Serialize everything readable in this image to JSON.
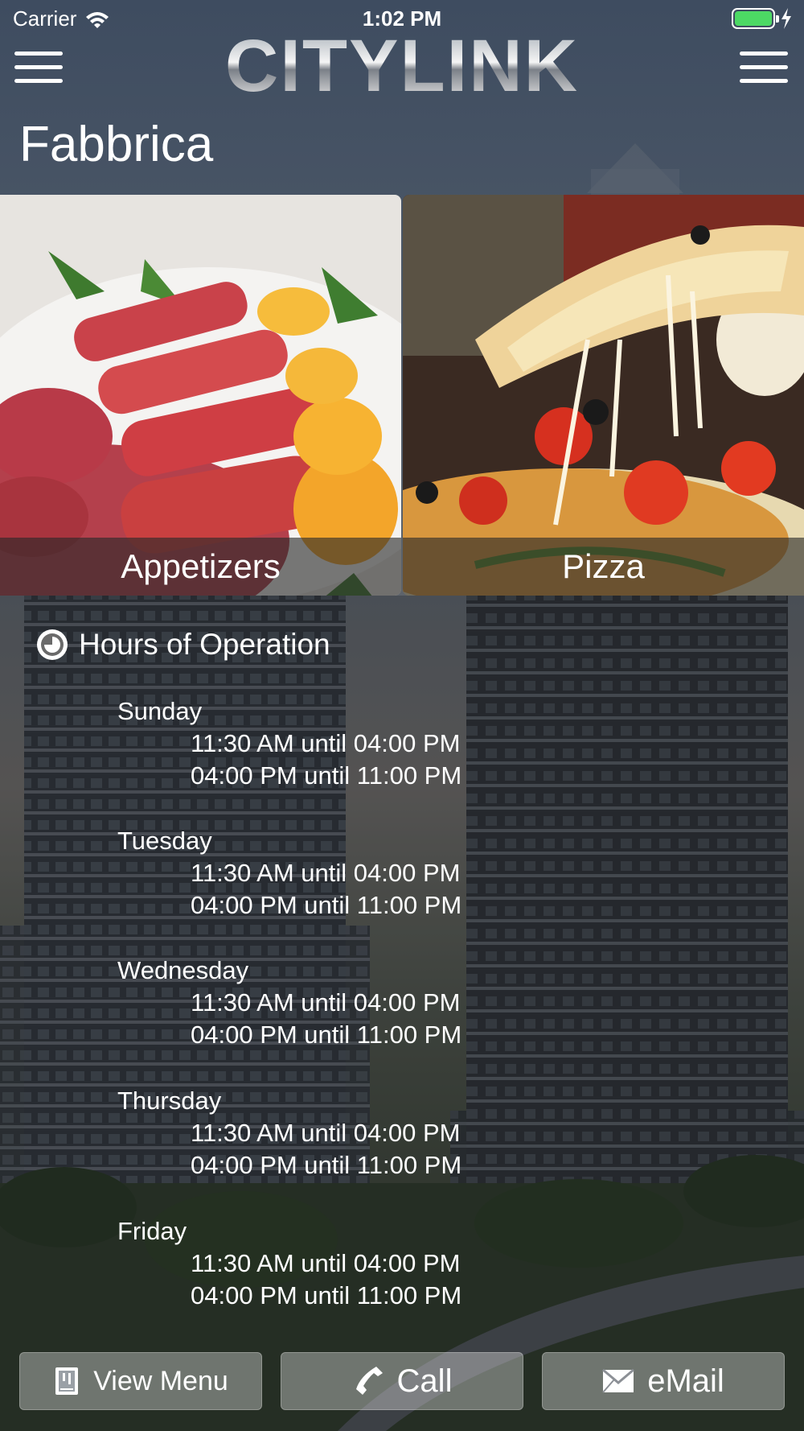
{
  "status_bar": {
    "carrier": "Carrier",
    "time": "1:02 PM",
    "battery_color": "#4cd964"
  },
  "header": {
    "logo_text": "CITYLINK",
    "left_menu_icon": "hamburger-icon",
    "right_menu_icon": "hamburger-icon"
  },
  "page": {
    "title": "Fabbrica"
  },
  "categories": [
    {
      "label": "Appetizers"
    },
    {
      "label": "Pizza"
    }
  ],
  "hours": {
    "title": "Hours of Operation",
    "icon": "clock-icon",
    "days": [
      {
        "day": "Sunday",
        "slots": [
          "11:30 AM until 04:00 PM",
          "04:00 PM until 11:00 PM"
        ]
      },
      {
        "day": "Tuesday",
        "slots": [
          "11:30 AM until 04:00 PM",
          "04:00 PM until 11:00 PM"
        ]
      },
      {
        "day": "Wednesday",
        "slots": [
          "11:30 AM until 04:00 PM",
          "04:00 PM until 11:00 PM"
        ]
      },
      {
        "day": "Thursday",
        "slots": [
          "11:30 AM until 04:00 PM",
          "04:00 PM until 11:00 PM"
        ]
      },
      {
        "day": "Friday",
        "slots": [
          "11:30 AM until 04:00 PM",
          "04:00 PM until 11:00 PM"
        ]
      }
    ]
  },
  "actions": {
    "view_menu": {
      "label": "View Menu",
      "icon": "menu-book-icon"
    },
    "call": {
      "label": "Call",
      "icon": "phone-icon"
    },
    "email": {
      "label": "eMail",
      "icon": "envelope-icon"
    }
  }
}
